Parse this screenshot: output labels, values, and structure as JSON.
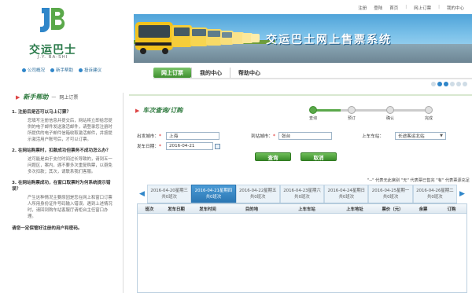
{
  "logo": {
    "cn": "交运巴士",
    "en": "J.Y. BA-SHI"
  },
  "site_links": [
    "公司概况",
    "新手帮助",
    "投诉建议"
  ],
  "top_links": [
    "注册",
    "登陆",
    "首页",
    "网上订票",
    "我的中心"
  ],
  "banner_title": "交运巴士网上售票系统",
  "nav": [
    "网上订票",
    "我的中心",
    "帮助中心"
  ],
  "sidebar": {
    "title": "新手帮助",
    "subtitle": "网上订票",
    "faqs": [
      {
        "q": "1. 注册后是否可以马上订票？",
        "a": "您填写注册信息并提交后，网站将立即给您提供的电子邮件发送激活邮件，请登录您注册时所提供的电子邮件信箱收取激活邮件，并按提示激活用户账号后，才可以订票。"
      },
      {
        "q": "2. 在网站购票时，扣款成功但票务不成功怎么办？",
        "a": "这可能是由于支付时间过长导致的，请到五一问题区，案内，遇不要多次重复购票，以避免多次扣款；其次，请联系我们客服。"
      },
      {
        "q": "3. 在网站购票成功，在窗口取票时为何系统提示错误？",
        "a": "产生这种情况主要原因是您在网上和窗口订票人所用身份证件号码输入错误。遇到上述情况时，请回到购车站客服厅请柜台主任窗口办理。"
      }
    ],
    "tip": "请您一定保管好注册的用户和密码。"
  },
  "main": {
    "title": "车次查询/订购",
    "steps": [
      "查询",
      "预订",
      "确认",
      "完成"
    ],
    "from_label": "出发城市：",
    "from_value": "上海",
    "to_label": "到站城市：",
    "to_value": "张台",
    "station_label": "上车车站：",
    "station_value": "长途客运北站",
    "date_label": "发车日期：",
    "date_value": "2016-04-21",
    "btn_query": "查询",
    "btn_cancel": "取消",
    "legend": "\"--\" 代表无此席别 \"无\" 代表票已售完 \"有\" 代表票源充足",
    "date_tabs": [
      {
        "date": "2016-04-20星期三",
        "count": "共0班次"
      },
      {
        "date": "2016-04-21星期四",
        "count": "共0班次"
      },
      {
        "date": "2016-04-22星期五",
        "count": "共0班次"
      },
      {
        "date": "2016-04-23星期六",
        "count": "共0班次"
      },
      {
        "date": "2016-04-24星期日",
        "count": "共0班次"
      },
      {
        "date": "2016-04-25星期一",
        "count": "共0班次"
      },
      {
        "date": "2016-04-26星期二",
        "count": "共0班次"
      }
    ],
    "columns": [
      "班次",
      "发车日期",
      "发车时间",
      "目的地",
      "上车车站",
      "上车地址",
      "票价（元）",
      "余票",
      "订购"
    ]
  }
}
